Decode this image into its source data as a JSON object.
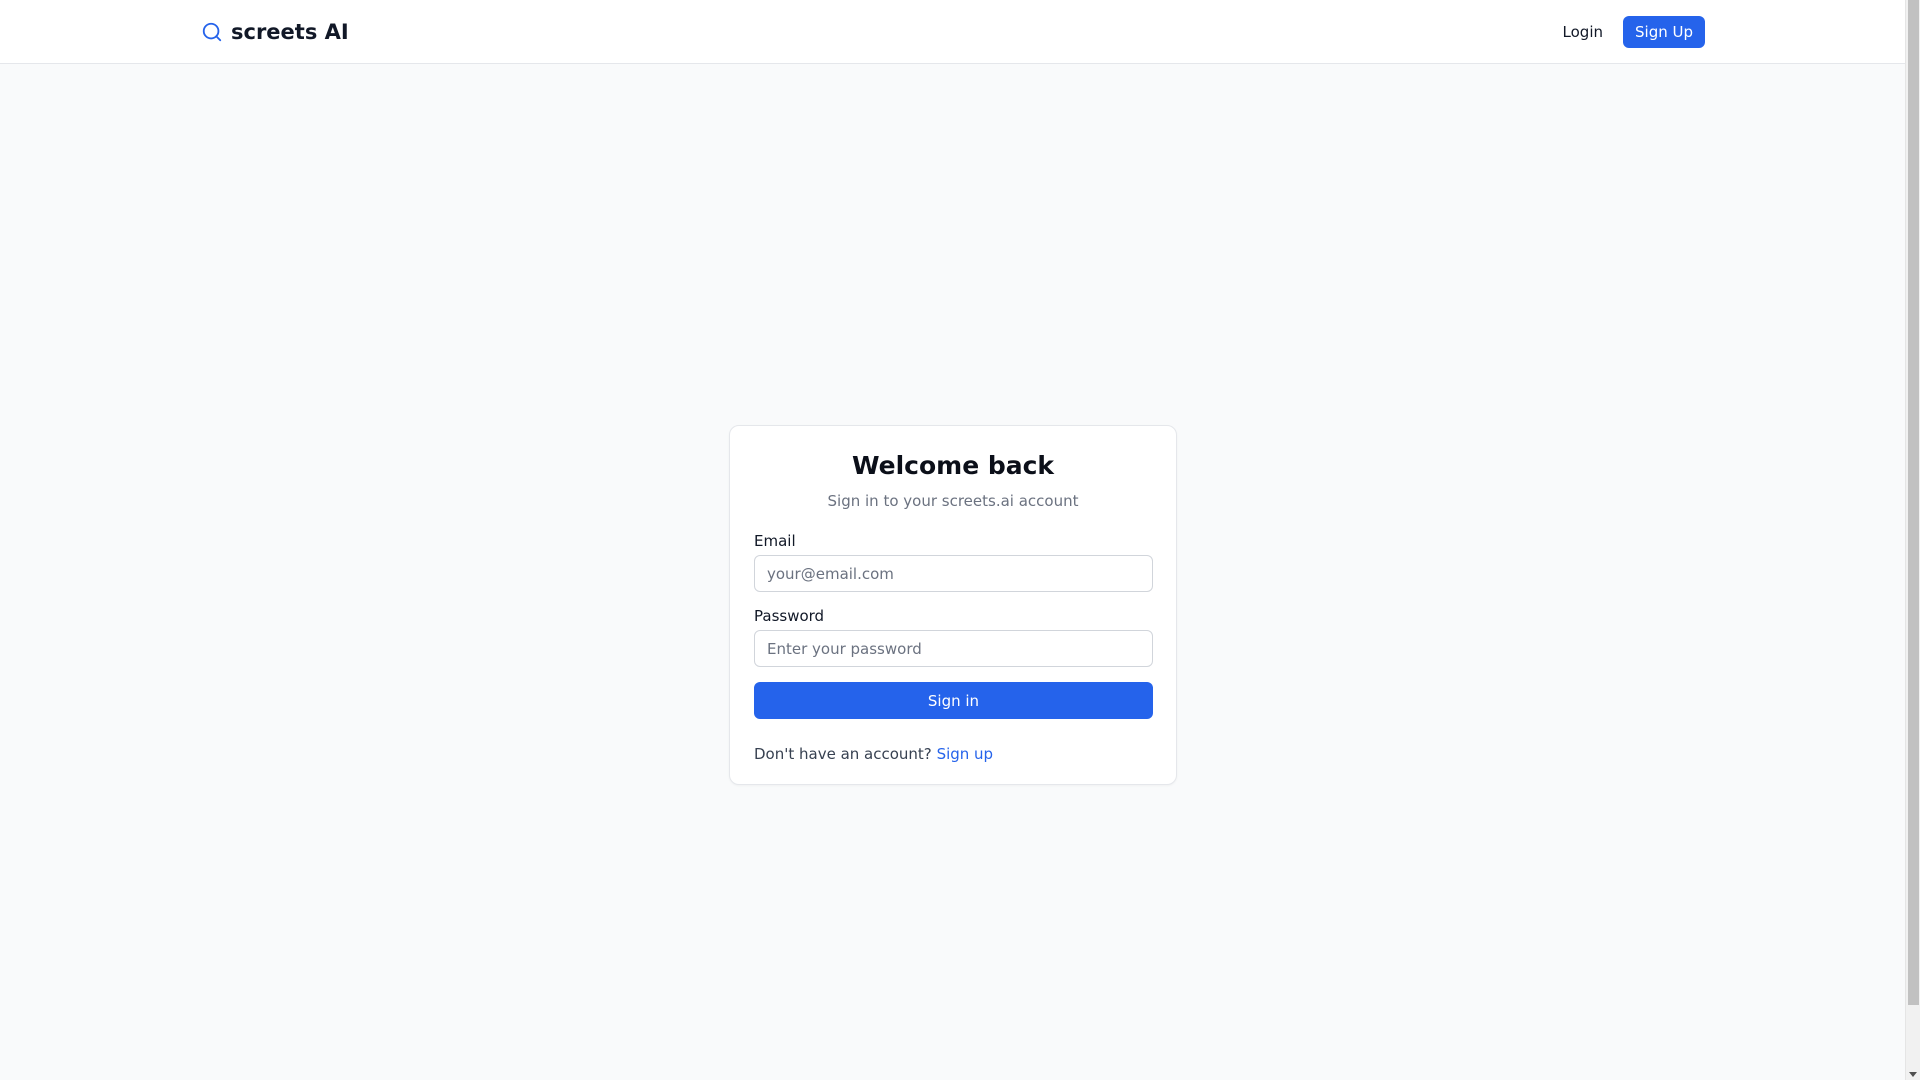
{
  "header": {
    "brand_name": "screets AI",
    "brand_icon": "search-icon",
    "login_label": "Login",
    "signup_label": "Sign Up"
  },
  "login_card": {
    "title": "Welcome back",
    "subtitle": "Sign in to your screets.ai account",
    "email_label": "Email",
    "email_placeholder": "your@email.com",
    "email_value": "",
    "password_label": "Password",
    "password_placeholder": "Enter your password",
    "password_value": "",
    "submit_label": "Sign in",
    "no_account_text": "Don't have an account?",
    "signup_link_label": "Sign up"
  },
  "colors": {
    "accent": "#2563eb",
    "background": "#f9fafb",
    "card": "#ffffff",
    "border": "#e5e7eb",
    "muted_text": "#6b7280"
  }
}
